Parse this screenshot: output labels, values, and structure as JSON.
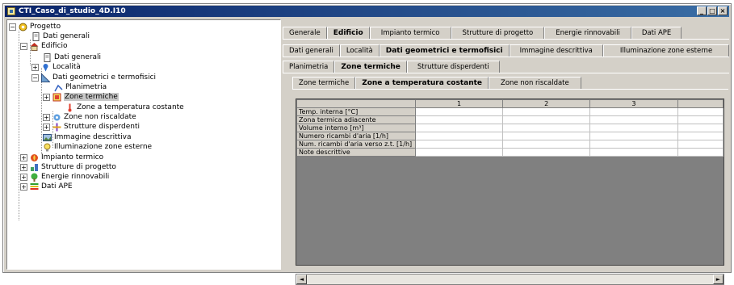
{
  "window": {
    "title": "CTI_Caso_di_studio_4D.I10"
  },
  "tree": [
    {
      "label": "Progetto",
      "icon": "project-gear-icon",
      "expander": "−"
    },
    {
      "label": "Dati generali",
      "icon": "document-icon"
    },
    {
      "label": "Edificio",
      "icon": "house-icon",
      "expander": "−"
    },
    {
      "label": "Dati generali",
      "icon": "document-icon"
    },
    {
      "label": "Località",
      "icon": "location-icon",
      "expander": "+"
    },
    {
      "label": "Dati geometrici e termofisici",
      "icon": "ruler-icon",
      "expander": "−"
    },
    {
      "label": "Planimetria",
      "icon": "floorplan-icon"
    },
    {
      "label": "Zone termiche",
      "icon": "thermal-zone-icon",
      "expander": "+"
    },
    {
      "label": "Zone a temperatura costante",
      "icon": "thermometer-icon"
    },
    {
      "label": "Zone non riscaldate",
      "icon": "unheated-zone-icon",
      "expander": "+"
    },
    {
      "label": "Strutture disperdenti",
      "icon": "structure-icon",
      "expander": "+"
    },
    {
      "label": "Immagine descrittiva",
      "icon": "image-icon"
    },
    {
      "label": "Illuminazione zone esterne",
      "icon": "lightbulb-icon"
    },
    {
      "label": "Impianto termico",
      "icon": "heating-system-icon",
      "expander": "+"
    },
    {
      "label": "Strutture di progetto",
      "icon": "design-structures-icon",
      "expander": "+"
    },
    {
      "label": "Energie rinnovabili",
      "icon": "renewable-energy-icon",
      "expander": "+"
    },
    {
      "label": "Dati APE",
      "icon": "ape-icon",
      "expander": "+"
    }
  ],
  "tabs_level1": [
    "Generale",
    "Edificio",
    "Impianto termico",
    "Strutture di progetto",
    "Energie rinnovabili",
    "Dati APE"
  ],
  "tabs_level2": [
    "Dati generali",
    "Località",
    "Dati geometrici e termofisici",
    "Immagine descrittiva",
    "Illuminazione zone esterne"
  ],
  "tabs_level3": [
    "Planimetria",
    "Zone termiche",
    "Strutture disperdenti"
  ],
  "tabs_level4": [
    "Zone termiche",
    "Zone a temperatura costante",
    "Zone non riscaldate"
  ],
  "grid": {
    "columns": [
      "1",
      "2",
      "3"
    ],
    "rows": [
      "Temp. interna [°C]",
      "Zona termica adiacente",
      "Volume interno [m³]",
      "Numero ricambi d'aria [1/h]",
      "Num. ricambi d'aria verso z.t. [1/h]",
      "Note descrittive"
    ]
  },
  "scroll": {
    "left_arrow": "◄",
    "right_arrow": "►"
  },
  "window_buttons": {
    "minimize": "_",
    "maximize": "□",
    "close": "×"
  }
}
